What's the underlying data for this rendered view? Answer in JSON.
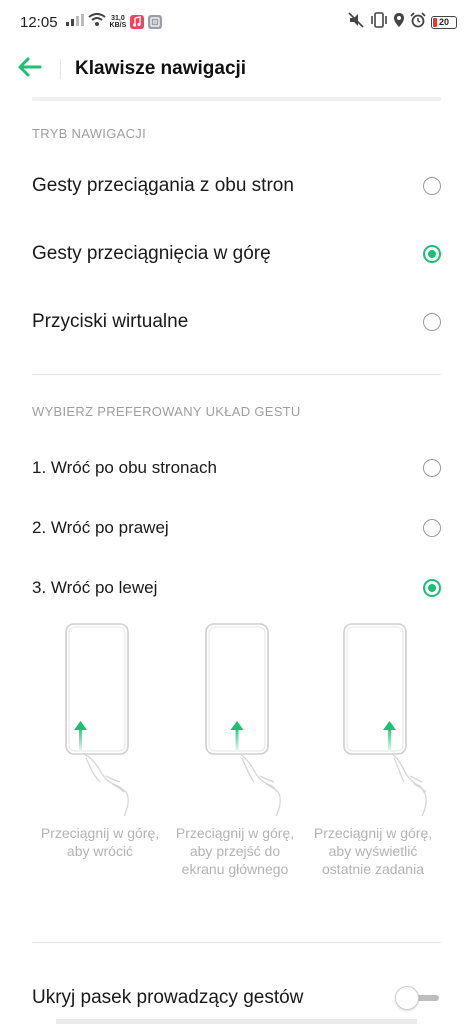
{
  "status_bar": {
    "time": "12:05",
    "net_speed_value": "31,0",
    "net_speed_unit": "KB/S",
    "battery_level": "20",
    "colors": {
      "music_app": "#f0435c",
      "notes_app": "#9b9fa6",
      "battery_low": "#e53935"
    }
  },
  "header": {
    "title": "Klawisze nawigacji"
  },
  "navigation_mode": {
    "section_title": "TRYB NAWIGACJI",
    "options": [
      {
        "label": "Gesty przeciągania z obu stron",
        "selected": false
      },
      {
        "label": "Gesty przeciągnięcia w górę",
        "selected": true
      },
      {
        "label": "Przyciski wirtualne",
        "selected": false
      }
    ]
  },
  "gesture_layout": {
    "section_title": "WYBIERZ PREFEROWANY UKŁAD GESTU",
    "options": [
      {
        "label": "1. Wróć po obu stronach",
        "selected": false
      },
      {
        "label": "2. Wróć po prawej",
        "selected": false
      },
      {
        "label": "3. Wróć po lewej",
        "selected": true
      }
    ],
    "illustrations": [
      {
        "caption": "Przeciągnij w górę, aby wrócić",
        "arrow_side": "left"
      },
      {
        "caption": "Przeciągnij w górę, aby przejść do ekranu głównego",
        "arrow_side": "center"
      },
      {
        "caption": "Przeciągnij w górę, aby wyświetlić ostatnie zadania",
        "arrow_side": "right"
      }
    ]
  },
  "hide_gesture_bar": {
    "label": "Ukryj pasek prowadzący gestów",
    "enabled": false
  },
  "colors": {
    "accent": "#1dbf73",
    "caption_gray": "#b3b3b3",
    "section_gray": "#9e9e9e"
  }
}
